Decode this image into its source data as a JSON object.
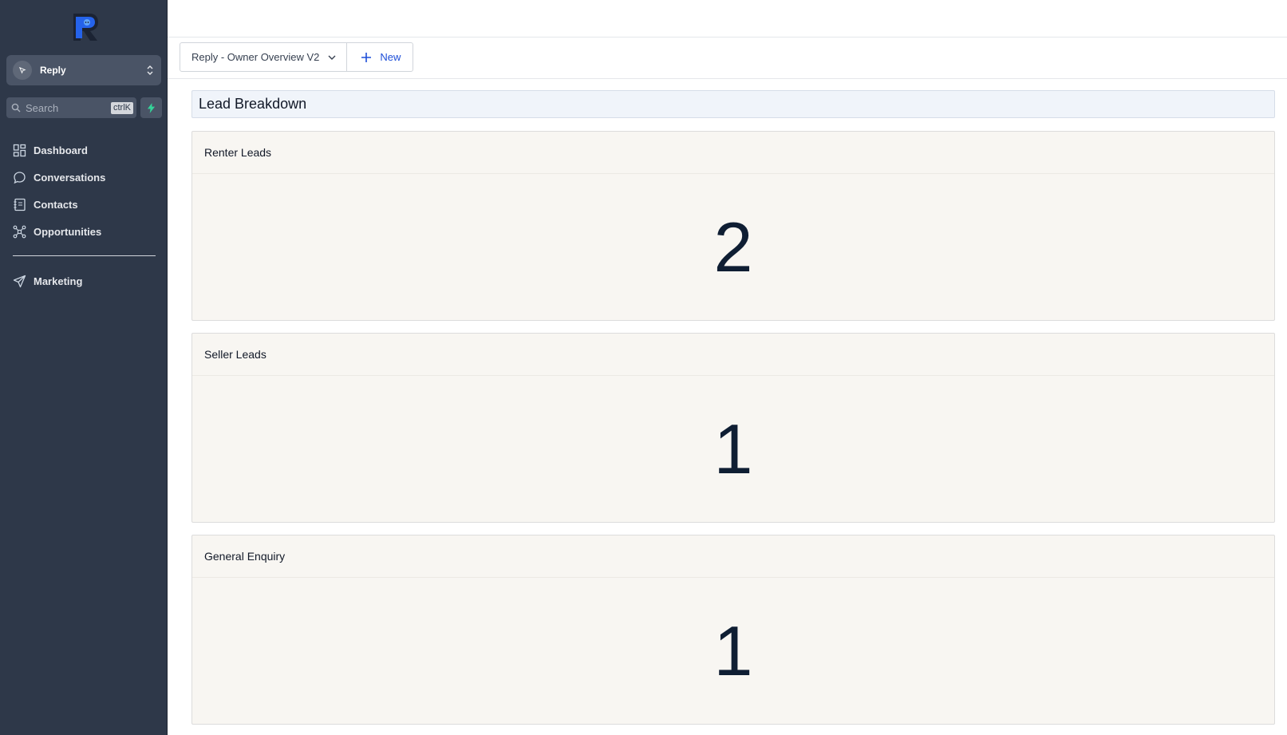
{
  "sidebar": {
    "account": {
      "name": "Reply"
    },
    "search": {
      "placeholder": "Search",
      "shortcut": "ctrlK"
    },
    "nav": [
      {
        "label": "Dashboard",
        "icon": "grid-icon"
      },
      {
        "label": "Conversations",
        "icon": "chat-bubble-icon"
      },
      {
        "label": "Contacts",
        "icon": "address-book-icon"
      },
      {
        "label": "Opportunities",
        "icon": "network-icon"
      }
    ],
    "nav_secondary": [
      {
        "label": "Marketing",
        "icon": "send-icon"
      }
    ]
  },
  "toolbar": {
    "dashboard_select": "Reply - Owner Overview V2",
    "new_label": "New"
  },
  "section": {
    "title": "Lead Breakdown"
  },
  "cards": [
    {
      "title": "Renter Leads",
      "value": "2"
    },
    {
      "title": "Seller Leads",
      "value": "1"
    },
    {
      "title": "General Enquiry",
      "value": "1"
    }
  ],
  "colors": {
    "sidebar_bg": "#2e3849",
    "accent": "#1d4ed8",
    "bolt": "#34d399",
    "card_bg": "#f8f6f2"
  }
}
